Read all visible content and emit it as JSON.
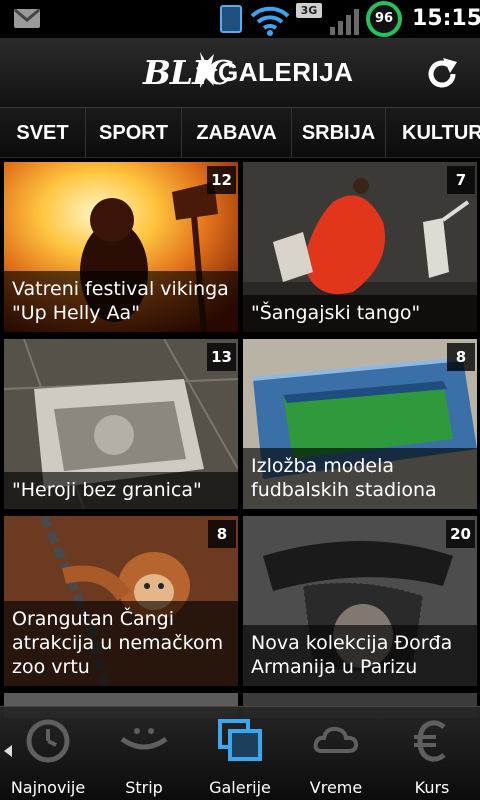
{
  "status_bar": {
    "network_type": "3G",
    "battery_percent": "96",
    "time": "15:15",
    "icons": [
      "gmail-icon",
      "phone-icon",
      "wifi-icon",
      "3g-icon",
      "signal-icon",
      "battery-icon"
    ]
  },
  "header": {
    "logo_brand": "BLIC",
    "logo_section": "GALERIJA",
    "refresh_icon": "refresh-icon"
  },
  "categories": [
    "SVET",
    "SPORT",
    "ZABAVA",
    "SRBIJA",
    "KULTURA"
  ],
  "gallery": [
    {
      "caption": "Vatreni festival vikinga \"Up Helly Aa\"",
      "count": "12"
    },
    {
      "caption": "\"Šangajski tango\"",
      "count": "7"
    },
    {
      "caption": "\"Heroji bez granica\"",
      "count": "13"
    },
    {
      "caption": "Izložba modela fudbalskih stadiona",
      "count": "8"
    },
    {
      "caption": "Orangutan Čangi atrakcija u nemačkom zoo vrtu",
      "count": "8"
    },
    {
      "caption": "Nova kolekcija Đorđa Armanija u Parizu",
      "count": "20"
    }
  ],
  "bottom_nav": [
    {
      "label": "Najnovije",
      "icon": "clock-icon"
    },
    {
      "label": "Strip",
      "icon": "smile-icon"
    },
    {
      "label": "Galerije",
      "icon": "gallery-icon"
    },
    {
      "label": "Vreme",
      "icon": "cloud-icon"
    },
    {
      "label": "Kurs",
      "icon": "euro-icon"
    }
  ],
  "colors": {
    "accent_blue": "#39a8f0",
    "battery_green": "#22c35e",
    "background": "#000000"
  }
}
